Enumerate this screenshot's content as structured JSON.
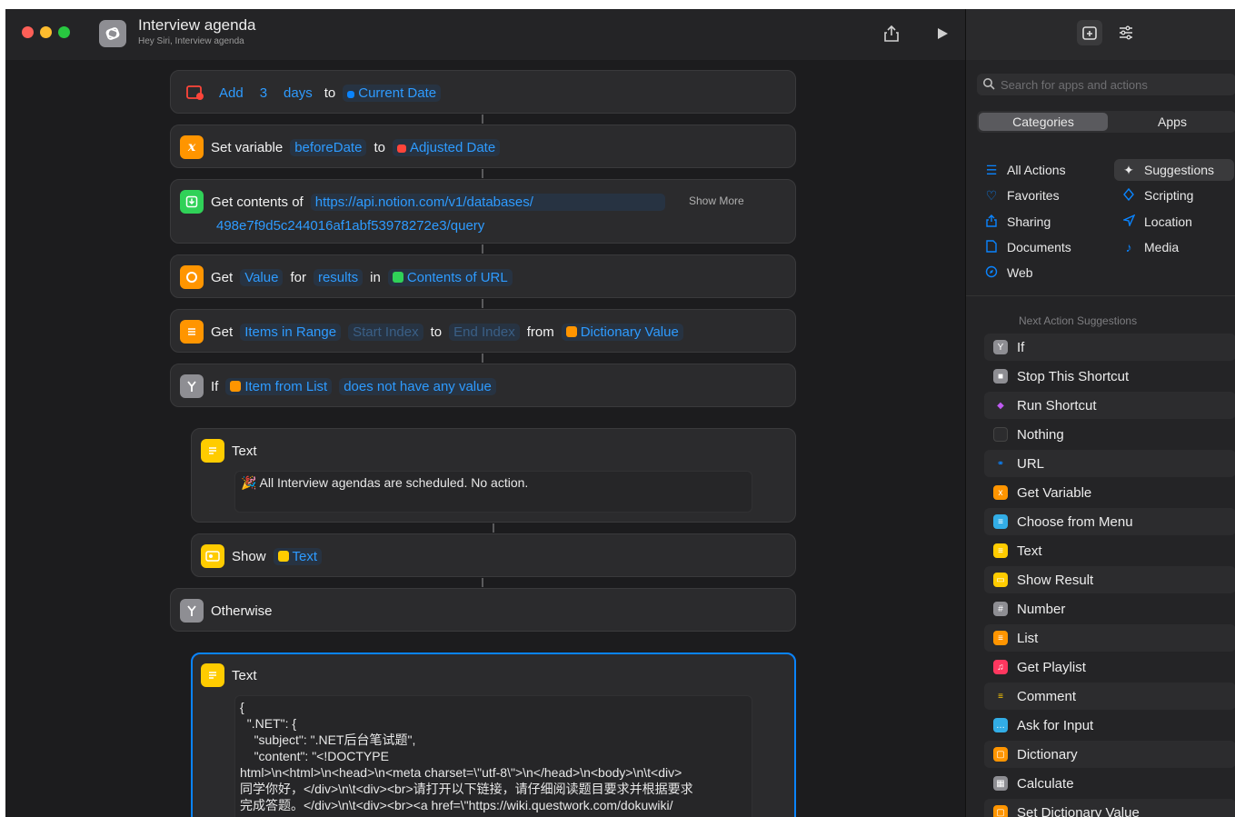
{
  "window": {
    "title": "Interview agenda",
    "subtitle": "Hey Siri, Interview agenda"
  },
  "actions": {
    "add": {
      "verb": "Add",
      "amount": "3",
      "unit": "days",
      "to": "to",
      "target": "Current Date"
    },
    "set_variable": {
      "verb": "Set variable",
      "name": "beforeDate",
      "to": "to",
      "value": "Adjusted Date"
    },
    "get_contents": {
      "verb": "Get contents of",
      "url_line1": "https://api.notion.com/v1/databases/",
      "url_line2": "498e7f9d5c244016af1abf53978272e3/query",
      "show_more": "Show More"
    },
    "get_value": {
      "verb": "Get",
      "key": "Value",
      "for": "for",
      "field": "results",
      "in": "in",
      "source": "Contents of URL"
    },
    "get_items": {
      "verb": "Get",
      "what": "Items in Range",
      "start_placeholder": "Start Index",
      "to": "to",
      "end_placeholder": "End Index",
      "from": "from",
      "source": "Dictionary Value"
    },
    "if": {
      "verb": "If",
      "subject": "Item from List",
      "condition": "does not have any value"
    },
    "text1": {
      "title": "Text",
      "body": "🎉 All Interview agendas are scheduled. No action."
    },
    "show": {
      "verb": "Show",
      "value": "Text"
    },
    "otherwise": {
      "verb": "Otherwise"
    },
    "text2": {
      "title": "Text",
      "body": "{\n  \".NET\": {\n    \"subject\": \".NET后台笔试题\",\n    \"content\": \"<!DOCTYPE\nhtml>\\n<html>\\n<head>\\n<meta charset=\\\"utf-8\\\">\\n</head>\\n<body>\\n\\t<div>\n同学你好，</div>\\n\\t<div><br>请打开以下链接，请仔细阅读题目要求并根据要求\n完成答题。</div>\\n\\t<div><br><a href=\\\"https://wiki.questwork.com/dokuwiki/"
    }
  },
  "sidebar": {
    "search_placeholder": "Search for apps and actions",
    "segments": [
      "Categories",
      "Apps"
    ],
    "categories_left": [
      {
        "label": "All Actions",
        "icon": "list-icon"
      },
      {
        "label": "Favorites",
        "icon": "heart-icon"
      },
      {
        "label": "Sharing",
        "icon": "share-icon"
      },
      {
        "label": "Documents",
        "icon": "document-icon"
      },
      {
        "label": "Web",
        "icon": "compass-icon"
      }
    ],
    "categories_right": [
      {
        "label": "Suggestions",
        "icon": "sparkle-icon"
      },
      {
        "label": "Scripting",
        "icon": "scripting-icon"
      },
      {
        "label": "Location",
        "icon": "location-icon"
      },
      {
        "label": "Media",
        "icon": "music-note-icon"
      }
    ],
    "suggestions_heading": "Next Action Suggestions",
    "suggestions": [
      {
        "label": "If",
        "color": "#8e8e93"
      },
      {
        "label": "Stop This Shortcut",
        "color": "#8e8e93"
      },
      {
        "label": "Run Shortcut",
        "color": "#5e5ce6"
      },
      {
        "label": "Nothing",
        "color": "#2c2c2e"
      },
      {
        "label": "URL",
        "color": "#2c2c2e"
      },
      {
        "label": "Get Variable",
        "color": "#ff9500"
      },
      {
        "label": "Choose from Menu",
        "color": "#32ade6"
      },
      {
        "label": "Text",
        "color": "#ffcc00"
      },
      {
        "label": "Show Result",
        "color": "#ffcc00"
      },
      {
        "label": "Number",
        "color": "#8e8e93"
      },
      {
        "label": "List",
        "color": "#ff9500"
      },
      {
        "label": "Get Playlist",
        "color": "#ff375f"
      },
      {
        "label": "Comment",
        "color": "#2c2c2e"
      },
      {
        "label": "Ask for Input",
        "color": "#32ade6"
      },
      {
        "label": "Dictionary",
        "color": "#ff9500"
      },
      {
        "label": "Calculate",
        "color": "#8e8e93"
      },
      {
        "label": "Set Dictionary Value",
        "color": "#ff9500"
      }
    ]
  }
}
